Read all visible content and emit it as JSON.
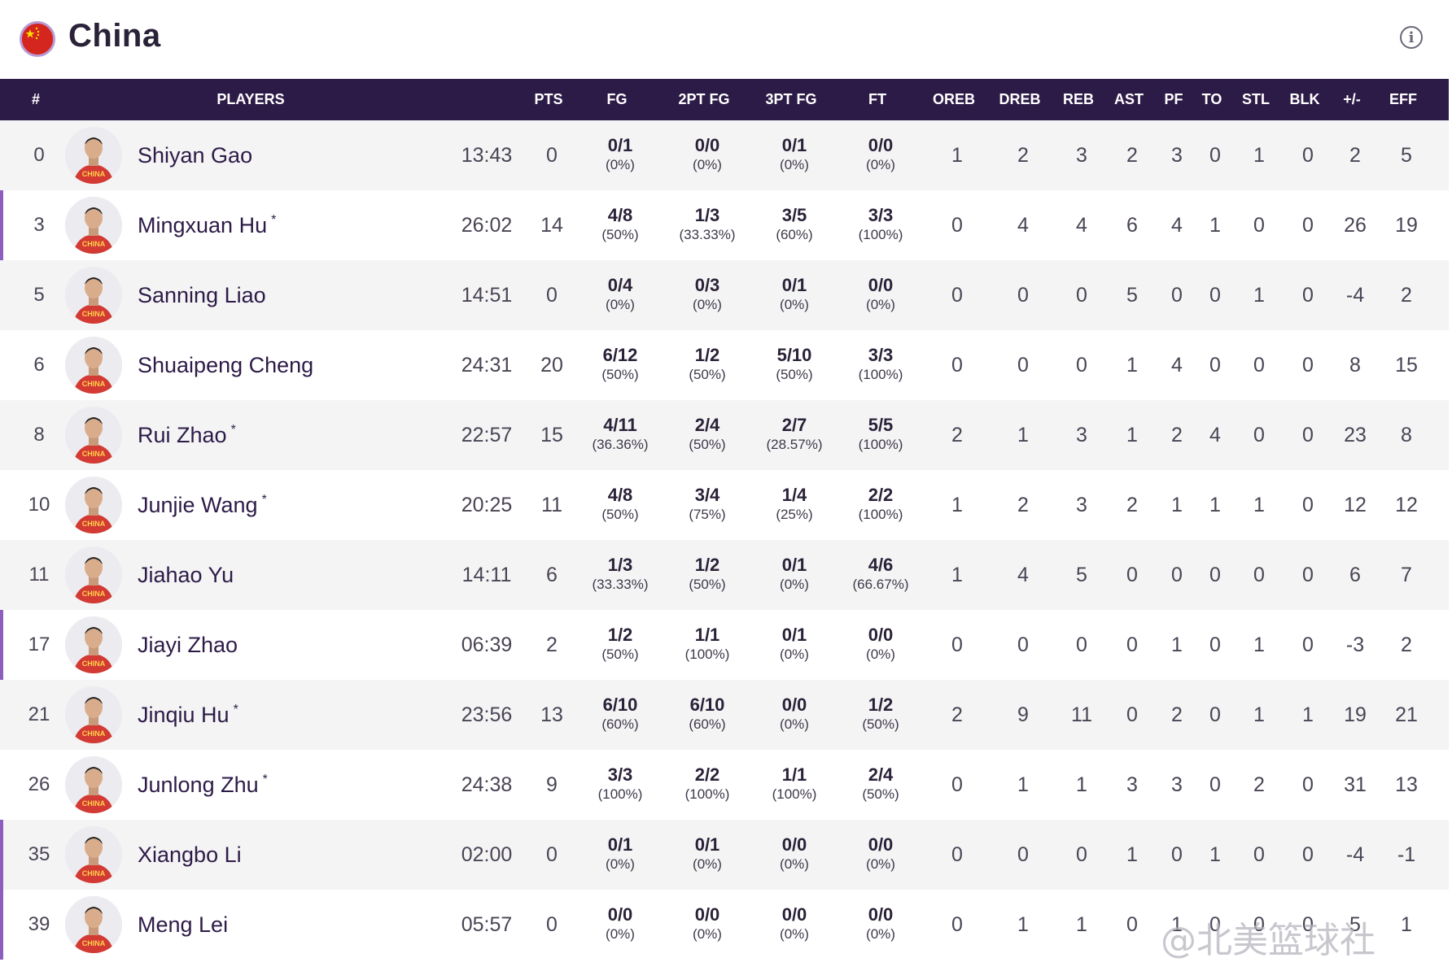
{
  "team": {
    "name": "China",
    "flag_icon": "china-flag-icon",
    "info_icon": "info-icon"
  },
  "colors": {
    "header_bg": "#2d1b47",
    "sub_marker": "#8c5fbf",
    "row_alt": "#f4f4f5",
    "player_name": "#2d1b47"
  },
  "columns": [
    "#",
    "PLAYERS",
    "PTS",
    "FG",
    "2PT FG",
    "3PT FG",
    "FT",
    "OREB",
    "DREB",
    "REB",
    "AST",
    "PF",
    "TO",
    "STL",
    "BLK",
    "+/-",
    "EFF"
  ],
  "players": [
    {
      "no": "0",
      "name": "Shiyan Gao",
      "starter": "",
      "min": "13:43",
      "pts": "0",
      "fg": "0/1",
      "fg_pct": "(0%)",
      "fg2": "0/0",
      "fg2_pct": "(0%)",
      "fg3": "0/1",
      "fg3_pct": "(0%)",
      "ft": "0/0",
      "ft_pct": "(0%)",
      "oreb": "1",
      "dreb": "2",
      "reb": "3",
      "ast": "2",
      "pf": "3",
      "to": "0",
      "stl": "1",
      "blk": "0",
      "pm": "2",
      "eff": "5"
    },
    {
      "no": "3",
      "name": "Mingxuan Hu",
      "starter": "*",
      "min": "26:02",
      "pts": "14",
      "fg": "4/8",
      "fg_pct": "(50%)",
      "fg2": "1/3",
      "fg2_pct": "(33.33%)",
      "fg3": "3/5",
      "fg3_pct": "(60%)",
      "ft": "3/3",
      "ft_pct": "(100%)",
      "oreb": "0",
      "dreb": "4",
      "reb": "4",
      "ast": "6",
      "pf": "4",
      "to": "1",
      "stl": "0",
      "blk": "0",
      "pm": "26",
      "eff": "19"
    },
    {
      "no": "5",
      "name": "Sanning Liao",
      "starter": "",
      "min": "14:51",
      "pts": "0",
      "fg": "0/4",
      "fg_pct": "(0%)",
      "fg2": "0/3",
      "fg2_pct": "(0%)",
      "fg3": "0/1",
      "fg3_pct": "(0%)",
      "ft": "0/0",
      "ft_pct": "(0%)",
      "oreb": "0",
      "dreb": "0",
      "reb": "0",
      "ast": "5",
      "pf": "0",
      "to": "0",
      "stl": "1",
      "blk": "0",
      "pm": "-4",
      "eff": "2"
    },
    {
      "no": "6",
      "name": "Shuaipeng Cheng",
      "starter": "",
      "min": "24:31",
      "pts": "20",
      "fg": "6/12",
      "fg_pct": "(50%)",
      "fg2": "1/2",
      "fg2_pct": "(50%)",
      "fg3": "5/10",
      "fg3_pct": "(50%)",
      "ft": "3/3",
      "ft_pct": "(100%)",
      "oreb": "0",
      "dreb": "0",
      "reb": "0",
      "ast": "1",
      "pf": "4",
      "to": "0",
      "stl": "0",
      "blk": "0",
      "pm": "8",
      "eff": "15"
    },
    {
      "no": "8",
      "name": "Rui Zhao",
      "starter": "*",
      "min": "22:57",
      "pts": "15",
      "fg": "4/11",
      "fg_pct": "(36.36%)",
      "fg2": "2/4",
      "fg2_pct": "(50%)",
      "fg3": "2/7",
      "fg3_pct": "(28.57%)",
      "ft": "5/5",
      "ft_pct": "(100%)",
      "oreb": "2",
      "dreb": "1",
      "reb": "3",
      "ast": "1",
      "pf": "2",
      "to": "4",
      "stl": "0",
      "blk": "0",
      "pm": "23",
      "eff": "8"
    },
    {
      "no": "10",
      "name": "Junjie Wang",
      "starter": "*",
      "min": "20:25",
      "pts": "11",
      "fg": "4/8",
      "fg_pct": "(50%)",
      "fg2": "3/4",
      "fg2_pct": "(75%)",
      "fg3": "1/4",
      "fg3_pct": "(25%)",
      "ft": "2/2",
      "ft_pct": "(100%)",
      "oreb": "1",
      "dreb": "2",
      "reb": "3",
      "ast": "2",
      "pf": "1",
      "to": "1",
      "stl": "1",
      "blk": "0",
      "pm": "12",
      "eff": "12"
    },
    {
      "no": "11",
      "name": "Jiahao Yu",
      "starter": "",
      "min": "14:11",
      "pts": "6",
      "fg": "1/3",
      "fg_pct": "(33.33%)",
      "fg2": "1/2",
      "fg2_pct": "(50%)",
      "fg3": "0/1",
      "fg3_pct": "(0%)",
      "ft": "4/6",
      "ft_pct": "(66.67%)",
      "oreb": "1",
      "dreb": "4",
      "reb": "5",
      "ast": "0",
      "pf": "0",
      "to": "0",
      "stl": "0",
      "blk": "0",
      "pm": "6",
      "eff": "7"
    },
    {
      "no": "17",
      "name": "Jiayi Zhao",
      "starter": "",
      "min": "06:39",
      "pts": "2",
      "fg": "1/2",
      "fg_pct": "(50%)",
      "fg2": "1/1",
      "fg2_pct": "(100%)",
      "fg3": "0/1",
      "fg3_pct": "(0%)",
      "ft": "0/0",
      "ft_pct": "(0%)",
      "oreb": "0",
      "dreb": "0",
      "reb": "0",
      "ast": "0",
      "pf": "1",
      "to": "0",
      "stl": "1",
      "blk": "0",
      "pm": "-3",
      "eff": "2"
    },
    {
      "no": "21",
      "name": "Jinqiu Hu",
      "starter": "*",
      "min": "23:56",
      "pts": "13",
      "fg": "6/10",
      "fg_pct": "(60%)",
      "fg2": "6/10",
      "fg2_pct": "(60%)",
      "fg3": "0/0",
      "fg3_pct": "(0%)",
      "ft": "1/2",
      "ft_pct": "(50%)",
      "oreb": "2",
      "dreb": "9",
      "reb": "11",
      "ast": "0",
      "pf": "2",
      "to": "0",
      "stl": "1",
      "blk": "1",
      "pm": "19",
      "eff": "21"
    },
    {
      "no": "26",
      "name": "Junlong Zhu",
      "starter": "*",
      "min": "24:38",
      "pts": "9",
      "fg": "3/3",
      "fg_pct": "(100%)",
      "fg2": "2/2",
      "fg2_pct": "(100%)",
      "fg3": "1/1",
      "fg3_pct": "(100%)",
      "ft": "2/4",
      "ft_pct": "(50%)",
      "oreb": "0",
      "dreb": "1",
      "reb": "1",
      "ast": "3",
      "pf": "3",
      "to": "0",
      "stl": "2",
      "blk": "0",
      "pm": "31",
      "eff": "13"
    },
    {
      "no": "35",
      "name": "Xiangbo Li",
      "starter": "",
      "min": "02:00",
      "pts": "0",
      "fg": "0/1",
      "fg_pct": "(0%)",
      "fg2": "0/1",
      "fg2_pct": "(0%)",
      "fg3": "0/0",
      "fg3_pct": "(0%)",
      "ft": "0/0",
      "ft_pct": "(0%)",
      "oreb": "0",
      "dreb": "0",
      "reb": "0",
      "ast": "1",
      "pf": "0",
      "to": "1",
      "stl": "0",
      "blk": "0",
      "pm": "-4",
      "eff": "-1"
    },
    {
      "no": "39",
      "name": "Meng Lei",
      "starter": "",
      "min": "05:57",
      "pts": "0",
      "fg": "0/0",
      "fg_pct": "(0%)",
      "fg2": "0/0",
      "fg2_pct": "(0%)",
      "fg3": "0/0",
      "fg3_pct": "(0%)",
      "ft": "0/0",
      "ft_pct": "(0%)",
      "oreb": "0",
      "dreb": "1",
      "reb": "1",
      "ast": "0",
      "pf": "1",
      "to": "0",
      "stl": "0",
      "blk": "0",
      "pm": "5",
      "eff": "1"
    }
  ],
  "watermark": "@北美篮球社"
}
